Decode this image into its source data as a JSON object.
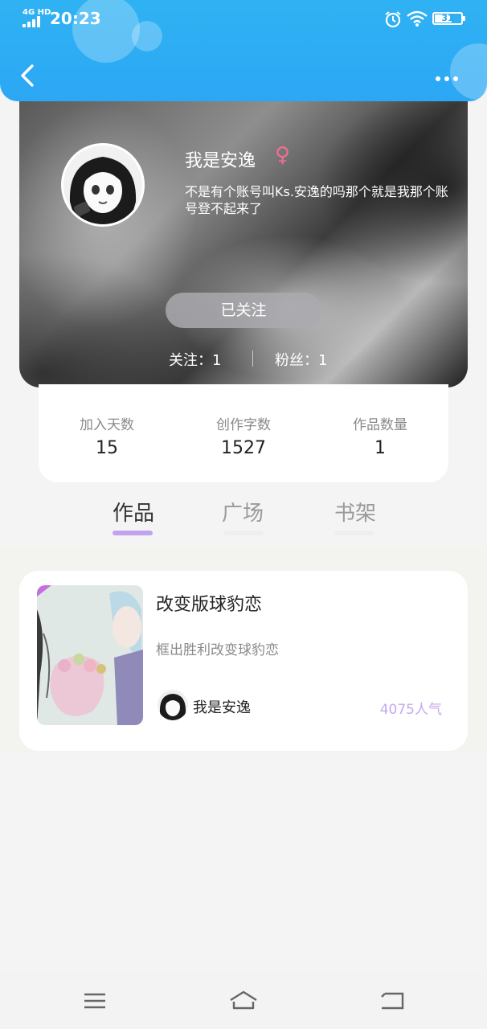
{
  "status_bar": {
    "network": "4G HD",
    "time": "20:23",
    "battery": "31",
    "icons": [
      "signal-icon",
      "alarm-icon",
      "wifi-icon",
      "battery-icon"
    ]
  },
  "header": {
    "back_icon": "chevron-left-icon",
    "more_icon": "more-dots-icon",
    "accent_color": "#2fb2f3"
  },
  "profile": {
    "nickname": "我是安逸",
    "gender_symbol": "♀",
    "gender_color": "#ef6f8f",
    "bio": "不是有个账号叫Ks.安逸的吗那个就是我那个账号登不起来了",
    "follow_button": "已关注",
    "following": "关注：1",
    "fans": "粉丝：1"
  },
  "stats": [
    {
      "label": "加入天数",
      "value": "15"
    },
    {
      "label": "创作字数",
      "value": "1527"
    },
    {
      "label": "作品数量",
      "value": "1"
    }
  ],
  "tabs": [
    {
      "label": "作品",
      "active": true
    },
    {
      "label": "广场",
      "active": false
    },
    {
      "label": "书架",
      "active": false
    }
  ],
  "tab_accent_color": "#c2a3f0",
  "works": [
    {
      "title": "改变版球豹恋",
      "description": "框出胜利改变球豹恋",
      "author": "我是安逸",
      "popularity": "4075人气"
    }
  ],
  "nav_bar": {
    "icons": [
      "menu-icon",
      "home-icon",
      "back-icon"
    ]
  }
}
